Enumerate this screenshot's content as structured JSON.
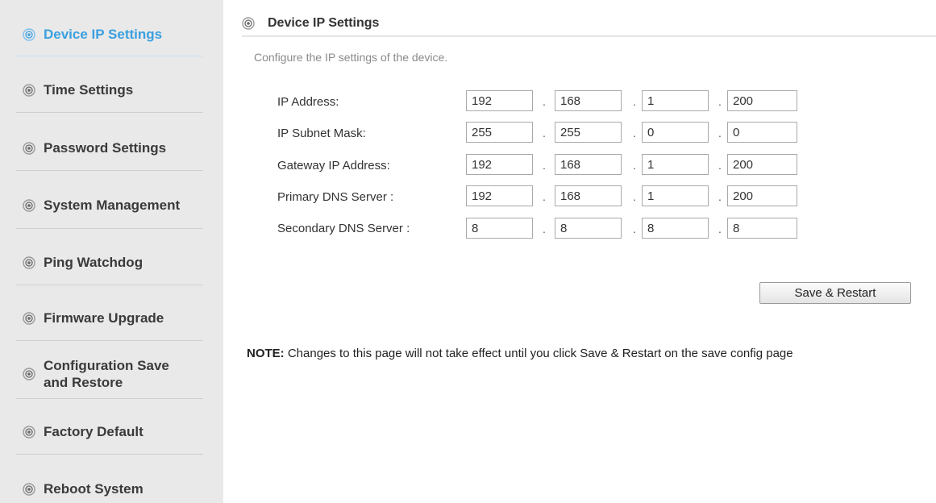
{
  "sidebar": {
    "items": [
      {
        "label": "Device IP Settings",
        "active": true
      },
      {
        "label": "Time Settings"
      },
      {
        "label": "Password Settings"
      },
      {
        "label": "System Management"
      },
      {
        "label": "Ping Watchdog"
      },
      {
        "label": "Firmware Upgrade"
      },
      {
        "label": "Configuration Save",
        "label2": "and Restore"
      },
      {
        "label": "Factory Default"
      },
      {
        "label": "Reboot System"
      }
    ]
  },
  "main": {
    "title": "Device IP Settings",
    "subtitle": "Configure the IP settings of the device.",
    "rows": [
      {
        "label": "IP Address:",
        "octets": [
          "192",
          "168",
          "1",
          "200"
        ]
      },
      {
        "label": "IP Subnet Mask:",
        "octets": [
          "255",
          "255",
          "0",
          "0"
        ]
      },
      {
        "label": "Gateway IP Address:",
        "octets": [
          "192",
          "168",
          "1",
          "200"
        ]
      },
      {
        "label": "Primary DNS Server :",
        "octets": [
          "192",
          "168",
          "1",
          "200"
        ]
      },
      {
        "label": "Secondary DNS Server :",
        "octets": [
          "8",
          "8",
          "8",
          "8"
        ]
      }
    ],
    "dot": ".",
    "save_label": "Save & Restart",
    "note_prefix": "NOTE:",
    "note_text": " Changes to this page will not take effect until you click Save & Restart on the save config page"
  },
  "colors": {
    "accent": "#3aa0e0",
    "sidebar_bg": "#e9e9e9"
  },
  "icons": {
    "nav": "radio-target-icon"
  }
}
